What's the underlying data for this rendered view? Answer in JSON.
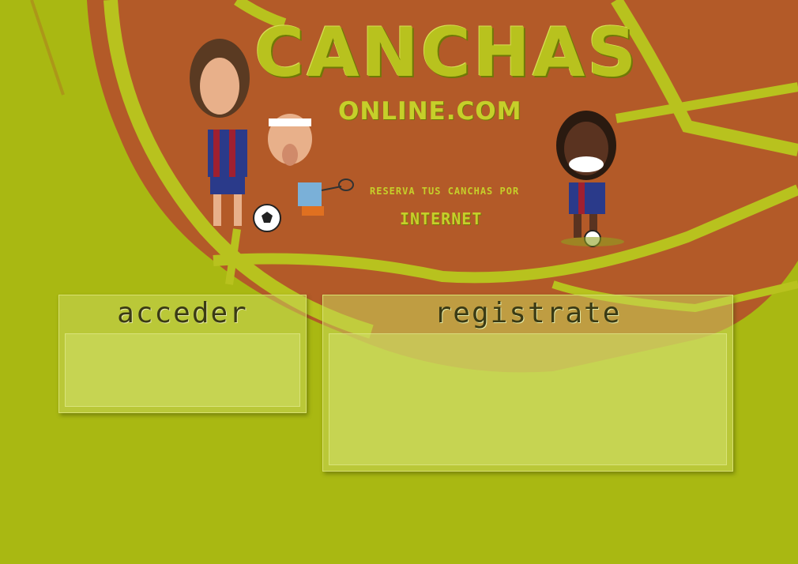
{
  "brand": {
    "title": "CANCHAS",
    "subtitle": "ONLINE.COM",
    "tagline_line1": "Reserva tus canchas por",
    "tagline_line2": "INTERNET"
  },
  "login_panel": {
    "title": "acceder"
  },
  "register_panel": {
    "title": "registrate"
  },
  "colors": {
    "background": "#a9b812",
    "court_clay": "#b35a28",
    "court_lines": "#b8c21e"
  }
}
